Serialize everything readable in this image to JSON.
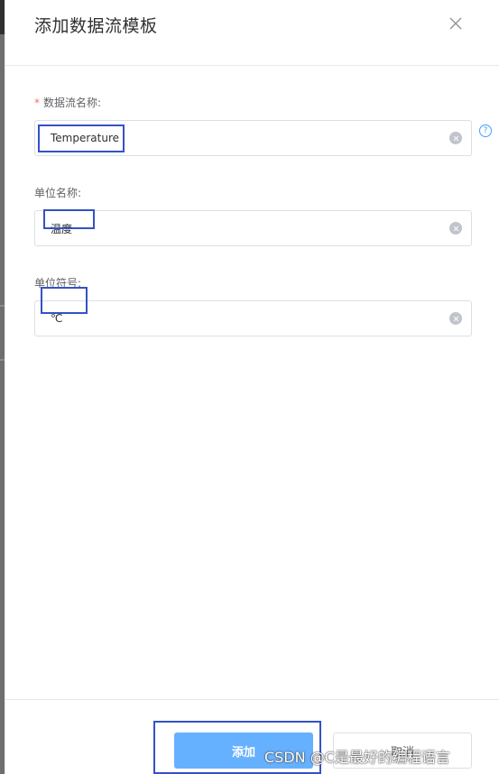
{
  "dialog": {
    "title": "添加数据流模板"
  },
  "form": {
    "stream_name": {
      "label": "数据流名称:",
      "required_mark": "*",
      "value": "Temperature",
      "help_glyph": "?"
    },
    "unit_name": {
      "label": "单位名称:",
      "value": "温度"
    },
    "unit_symbol": {
      "label": "单位符号:",
      "value": "℃"
    }
  },
  "footer": {
    "add_label": "添加",
    "cancel_label": "取消"
  },
  "watermark": "CSDN @C是最好的编程语言",
  "icons": {
    "close": "close-icon",
    "clear": "clear-icon",
    "help": "question-circle-icon"
  },
  "colors": {
    "primary": "#66b1ff",
    "help": "#409eff",
    "required": "#f56c6c",
    "highlight": "#3452c4"
  }
}
